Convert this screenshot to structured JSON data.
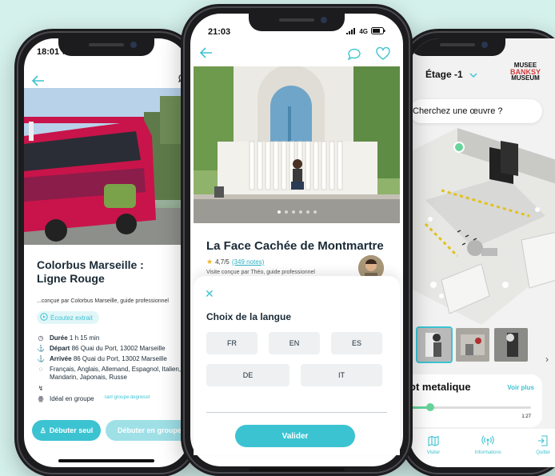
{
  "colors": {
    "accent": "#3cc3d2",
    "background": "#d5f1ec",
    "star": "#f3b51d",
    "progress": "#67d49c"
  },
  "phone_left": {
    "time": "18:01",
    "title": "Colorbus Marseille :\nLigne Rouge",
    "author": "...conçue par Colorbus Marseille, guide professionnel",
    "listen_label": "Écoutez extrait",
    "duration_label": "Durée",
    "duration_value": "1 h 15 min",
    "departure_label": "Départ",
    "departure_value": "86 Quai du Port, 13002 Marseille",
    "arrival_label": "Arrivée",
    "arrival_value": "86 Quai du Port, 13002 Marseille",
    "languages": "Français, Anglais, Allemand, Espagnol, Italien, Mandarin, Japonais, Russe",
    "group_text": "Idéal en groupe",
    "tarif_text": "Tarif groupe dégressif",
    "start_solo": "Débuter seul",
    "start_group": "Débuter en groupe"
  },
  "phone_center": {
    "time": "21:03",
    "network": "4G",
    "title": "La Face Cachée de Montmartre",
    "rating": "4,7/5",
    "notes": "(349 notes)",
    "author": "Visite conçue par Théo, guide professionnel",
    "sheet": {
      "close": "✕",
      "title": "Choix de la langue",
      "languages": [
        "FR",
        "EN",
        "ES",
        "DE",
        "IT"
      ],
      "validate": "Valider"
    }
  },
  "phone_right": {
    "floor": "Étage -1",
    "logo": {
      "line1": "MUSEE",
      "line2": "BANKSY",
      "line3": "MUSEUM"
    },
    "search": "Cherchez une œuvre ?",
    "player_title": "ot metalique",
    "see_more": "Voir plus",
    "duration": "1:27",
    "progress": 0.17,
    "tabs": {
      "visit": "Visiter",
      "info": "Informations",
      "quit": "Quitter"
    }
  }
}
